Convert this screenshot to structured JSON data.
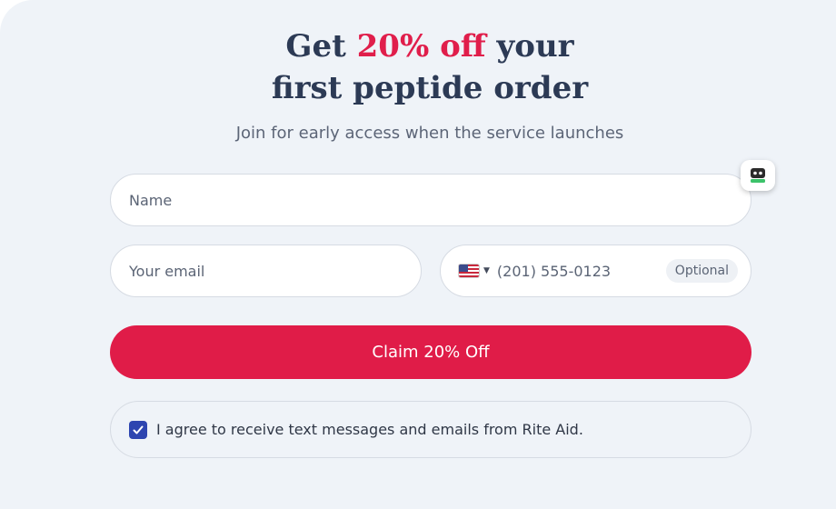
{
  "headline": {
    "prefix": "Get ",
    "highlight": "20% off",
    "suffix": " your",
    "line2": "first peptide order"
  },
  "subtitle": "Join for early access when the service launches",
  "form": {
    "name_placeholder": "Name",
    "email_placeholder": "Your email",
    "phone": {
      "country": "US",
      "placeholder": "(201) 555-0123",
      "badge": "Optional"
    },
    "submit_label": "Claim 20% Off",
    "consent": {
      "checked": true,
      "text": "I agree to receive text messages and emails from Rite Aid."
    }
  },
  "icons": {
    "flag": "us-flag-icon",
    "caret": "caret-down-icon",
    "check": "checkmark-icon",
    "widget": "password-manager-icon"
  },
  "colors": {
    "accent": "#e01e4b",
    "heading": "#2c3a55",
    "button": "#e01c48",
    "checkbox": "#2d45b0",
    "background": "#eff3f8"
  }
}
